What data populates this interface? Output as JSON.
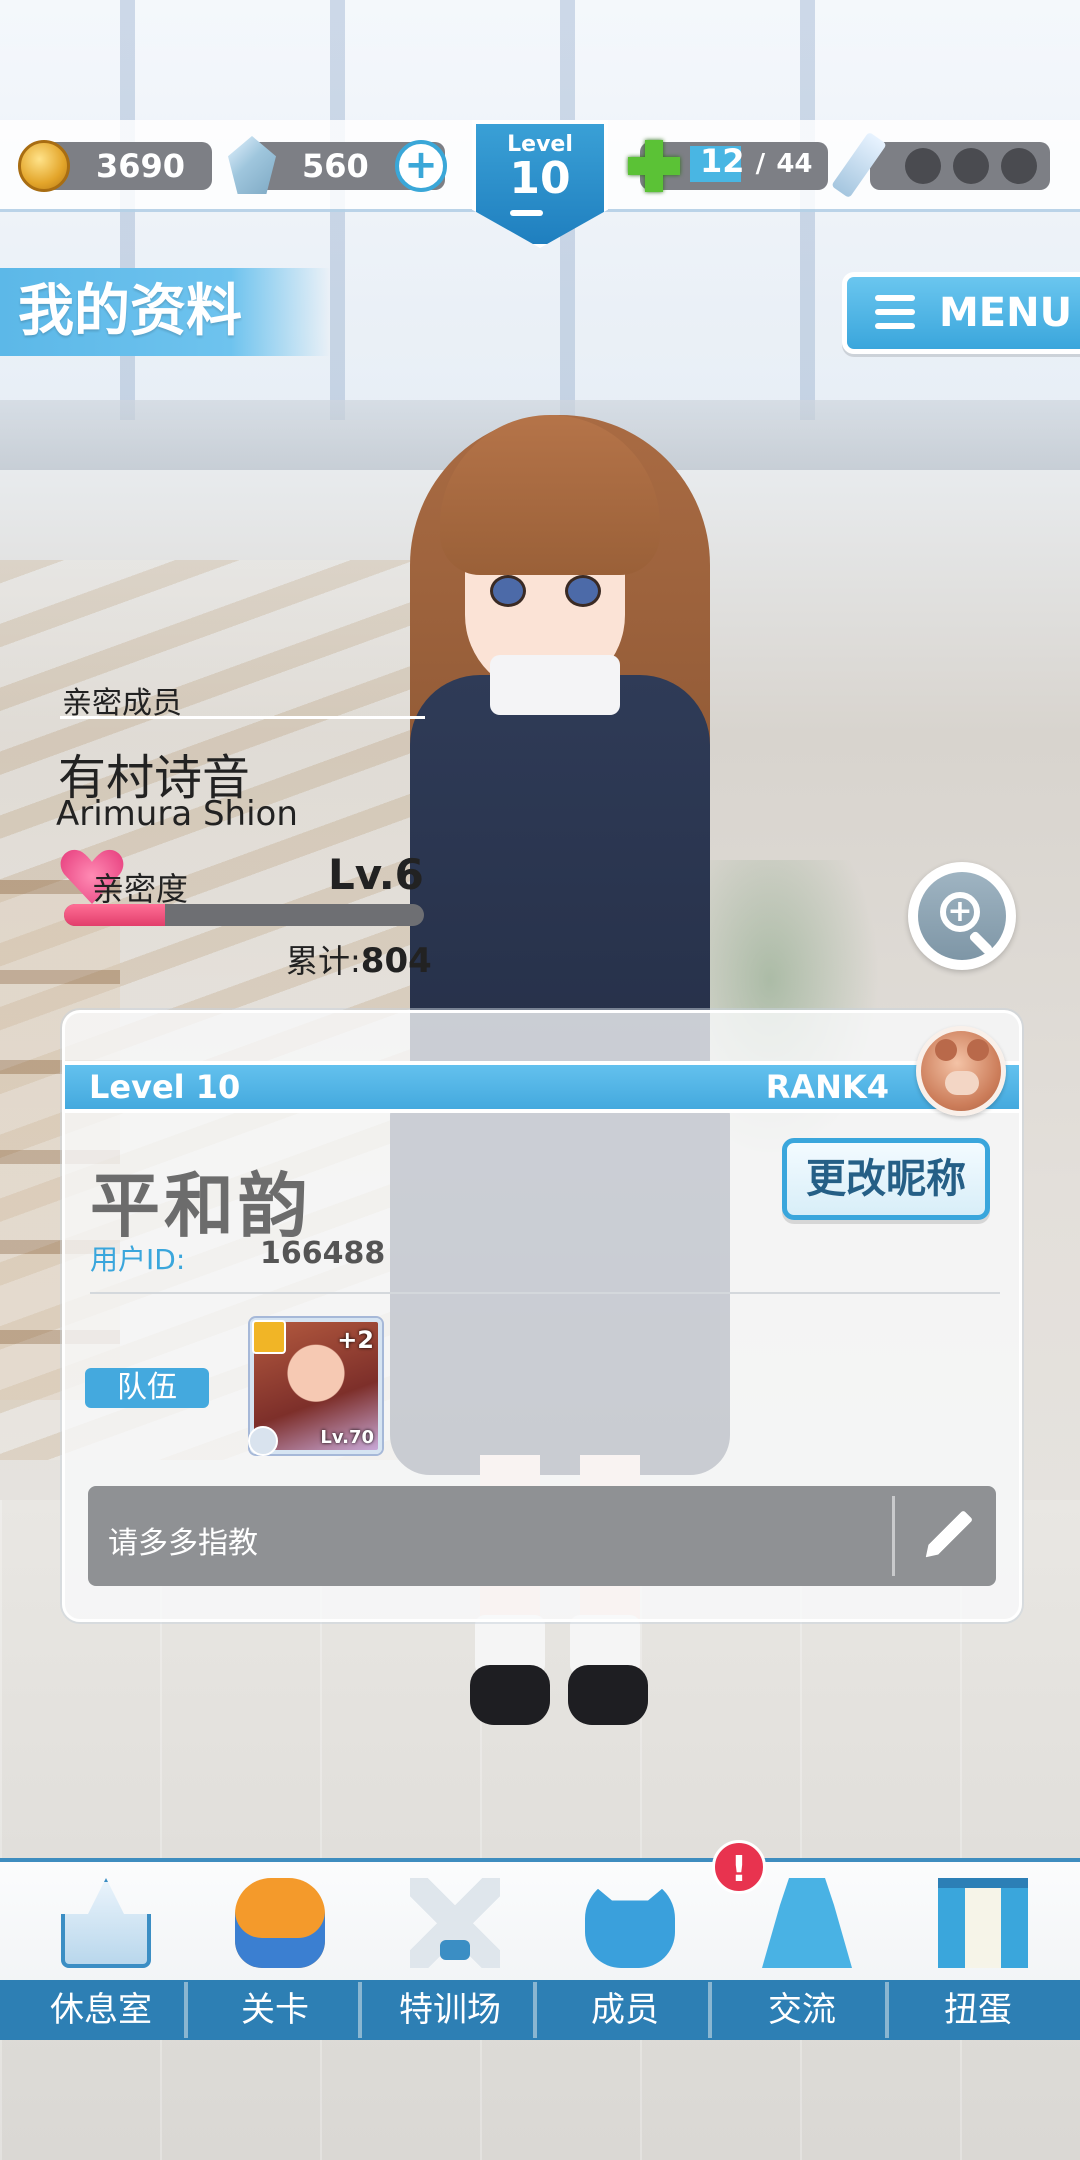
{
  "status_bar": {
    "coins": "3690",
    "gems": "560",
    "level_label": "Level",
    "level_value": "10",
    "level_progress": 0.5,
    "stamina_current": "12",
    "stamina_separator": "/",
    "stamina_max": "44",
    "stamina_fraction": 0.27,
    "sword_charges_filled": 0,
    "sword_charges_total": 3
  },
  "header": {
    "page_title": "我的资料",
    "menu_label": "MENU"
  },
  "intimacy": {
    "caption": "亲密成员",
    "member_name_cn": "有村诗音",
    "member_name_en": "Arimura Shion",
    "label": "亲密度",
    "level": "Lv.6",
    "progress": 0.28,
    "total_label": "累计:",
    "total_value": "804"
  },
  "profile": {
    "level_text": "Level 10",
    "rank_text": "RANK4",
    "nickname": "平和韵",
    "change_nickname_label": "更改昵称",
    "user_id_label": "用户ID:",
    "user_id": "166488",
    "team_label": "队伍",
    "team_card": {
      "plus": "+2",
      "level": "Lv.70"
    },
    "comment": "请多多指教"
  },
  "bottom_nav": {
    "items": [
      {
        "label": "休息室",
        "icon": "school-icon"
      },
      {
        "label": "关卡",
        "icon": "monster-icon"
      },
      {
        "label": "特训场",
        "icon": "crossed-swords-icon"
      },
      {
        "label": "成员",
        "icon": "cat-mask-icon"
      },
      {
        "label": "交流",
        "icon": "dress-icon"
      },
      {
        "label": "扭蛋",
        "icon": "curtain-icon"
      }
    ],
    "alert_badge": "!"
  },
  "colors": {
    "accent_blue": "#44a9de",
    "intimacy_pink": "#e23e6b",
    "alert_red": "#e8334f"
  }
}
